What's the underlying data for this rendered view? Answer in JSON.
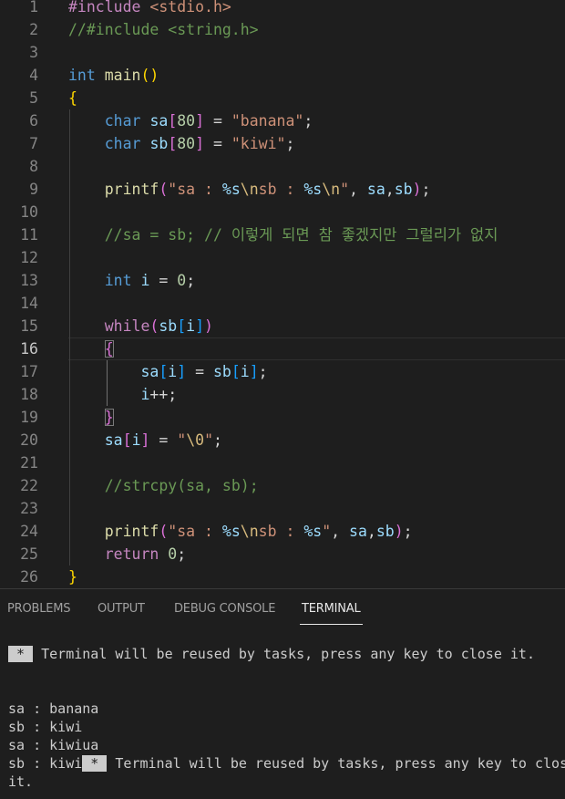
{
  "editor": {
    "active_line": 16,
    "lines": [
      {
        "n": "1",
        "tokens": [
          [
            "#include ",
            "ctl"
          ],
          [
            "<stdio.h>",
            "s"
          ]
        ]
      },
      {
        "n": "2",
        "tokens": [
          [
            "//#include <string.h>",
            "c"
          ]
        ]
      },
      {
        "n": "3",
        "tokens": []
      },
      {
        "n": "4",
        "tokens": [
          [
            "int",
            "k"
          ],
          [
            " ",
            "t"
          ],
          [
            "main",
            "f"
          ],
          [
            "()",
            "b1"
          ]
        ]
      },
      {
        "n": "5",
        "tokens": [
          [
            "{",
            "b1"
          ]
        ]
      },
      {
        "n": "6",
        "tokens": [
          [
            "    ",
            "t"
          ],
          [
            "char",
            "k"
          ],
          [
            " ",
            "t"
          ],
          [
            "sa",
            "v"
          ],
          [
            "[",
            "b2"
          ],
          [
            "80",
            "n"
          ],
          [
            "]",
            "b2"
          ],
          [
            " = ",
            "t"
          ],
          [
            "\"banana\"",
            "s"
          ],
          [
            ";",
            "t"
          ]
        ]
      },
      {
        "n": "7",
        "tokens": [
          [
            "    ",
            "t"
          ],
          [
            "char",
            "k"
          ],
          [
            " ",
            "t"
          ],
          [
            "sb",
            "v"
          ],
          [
            "[",
            "b2"
          ],
          [
            "80",
            "n"
          ],
          [
            "]",
            "b2"
          ],
          [
            " = ",
            "t"
          ],
          [
            "\"kiwi\"",
            "s"
          ],
          [
            ";",
            "t"
          ]
        ]
      },
      {
        "n": "8",
        "tokens": []
      },
      {
        "n": "9",
        "tokens": [
          [
            "    ",
            "t"
          ],
          [
            "printf",
            "f"
          ],
          [
            "(",
            "b2"
          ],
          [
            "\"sa : ",
            "s"
          ],
          [
            "%s",
            "v"
          ],
          [
            "\\n",
            "e"
          ],
          [
            "sb : ",
            "s"
          ],
          [
            "%s",
            "v"
          ],
          [
            "\\n",
            "e"
          ],
          [
            "\"",
            "s"
          ],
          [
            ", ",
            "t"
          ],
          [
            "sa",
            "v"
          ],
          [
            ",",
            "t"
          ],
          [
            "sb",
            "v"
          ],
          [
            ")",
            "b2"
          ],
          [
            ";",
            "t"
          ]
        ]
      },
      {
        "n": "10",
        "tokens": []
      },
      {
        "n": "11",
        "tokens": [
          [
            "    ",
            "t"
          ],
          [
            "//sa = sb; // 이렇게 되면 참 좋겠지만 그럴리가 없지",
            "c"
          ]
        ]
      },
      {
        "n": "12",
        "tokens": []
      },
      {
        "n": "13",
        "tokens": [
          [
            "    ",
            "t"
          ],
          [
            "int",
            "k"
          ],
          [
            " ",
            "t"
          ],
          [
            "i",
            "v"
          ],
          [
            " = ",
            "t"
          ],
          [
            "0",
            "n"
          ],
          [
            ";",
            "t"
          ]
        ]
      },
      {
        "n": "14",
        "tokens": []
      },
      {
        "n": "15",
        "tokens": [
          [
            "    ",
            "t"
          ],
          [
            "while",
            "ctl"
          ],
          [
            "(",
            "b2"
          ],
          [
            "sb",
            "v"
          ],
          [
            "[",
            "b3"
          ],
          [
            "i",
            "v"
          ],
          [
            "]",
            "b3"
          ],
          [
            ")",
            "b2"
          ]
        ]
      },
      {
        "n": "16",
        "tokens": [
          [
            "    ",
            "t"
          ],
          [
            "{",
            "b2 bm"
          ]
        ]
      },
      {
        "n": "17",
        "tokens": [
          [
            "        ",
            "t"
          ],
          [
            "sa",
            "v"
          ],
          [
            "[",
            "b3"
          ],
          [
            "i",
            "v"
          ],
          [
            "]",
            "b3"
          ],
          [
            " = ",
            "t"
          ],
          [
            "sb",
            "v"
          ],
          [
            "[",
            "b3"
          ],
          [
            "i",
            "v"
          ],
          [
            "]",
            "b3"
          ],
          [
            ";",
            "t"
          ]
        ]
      },
      {
        "n": "18",
        "tokens": [
          [
            "        ",
            "t"
          ],
          [
            "i",
            "v"
          ],
          [
            "++;",
            "t"
          ]
        ]
      },
      {
        "n": "19",
        "tokens": [
          [
            "    ",
            "t"
          ],
          [
            "}",
            "b2 bm"
          ]
        ]
      },
      {
        "n": "20",
        "tokens": [
          [
            "    ",
            "t"
          ],
          [
            "sa",
            "v"
          ],
          [
            "[",
            "b2"
          ],
          [
            "i",
            "v"
          ],
          [
            "]",
            "b2"
          ],
          [
            " = ",
            "t"
          ],
          [
            "\"",
            "s"
          ],
          [
            "\\0",
            "e"
          ],
          [
            "\"",
            "s"
          ],
          [
            ";",
            "t"
          ]
        ]
      },
      {
        "n": "21",
        "tokens": []
      },
      {
        "n": "22",
        "tokens": [
          [
            "    ",
            "t"
          ],
          [
            "//strcpy(sa, sb);",
            "c"
          ]
        ]
      },
      {
        "n": "23",
        "tokens": []
      },
      {
        "n": "24",
        "tokens": [
          [
            "    ",
            "t"
          ],
          [
            "printf",
            "f"
          ],
          [
            "(",
            "b2"
          ],
          [
            "\"sa : ",
            "s"
          ],
          [
            "%s",
            "v"
          ],
          [
            "\\n",
            "e"
          ],
          [
            "sb : ",
            "s"
          ],
          [
            "%s",
            "v"
          ],
          [
            "\"",
            "s"
          ],
          [
            ", ",
            "t"
          ],
          [
            "sa",
            "v"
          ],
          [
            ",",
            "t"
          ],
          [
            "sb",
            "v"
          ],
          [
            ")",
            "b2"
          ],
          [
            ";",
            "t"
          ]
        ]
      },
      {
        "n": "25",
        "tokens": [
          [
            "    ",
            "t"
          ],
          [
            "return",
            "ctl"
          ],
          [
            " ",
            "t"
          ],
          [
            "0",
            "n"
          ],
          [
            ";",
            "t"
          ]
        ]
      },
      {
        "n": "26",
        "tokens": [
          [
            "}",
            "b1"
          ]
        ]
      }
    ]
  },
  "panel": {
    "tabs": [
      "PROBLEMS",
      "OUTPUT",
      "DEBUG CONSOLE",
      "TERMINAL"
    ],
    "active_tab": "TERMINAL",
    "terminal": {
      "badge": " * ",
      "reuse_message": " Terminal will be reused by tasks, press any key to close it.",
      "output_1": "sa : banana",
      "output_2": "sb : kiwi",
      "output_3": "sa : kiwiua",
      "output_4_prefix": "sb : kiwi",
      "output_4_message": " Terminal will be reused by tasks, press any key to close",
      "output_5": "it."
    }
  },
  "colors": {
    "background": "#1e1e1e",
    "keyword": "#569cd6",
    "control": "#c586c0",
    "function": "#dcdcaa",
    "variable": "#9cdcfe",
    "string": "#ce9178",
    "comment": "#6a9955",
    "number": "#b5cea8"
  }
}
